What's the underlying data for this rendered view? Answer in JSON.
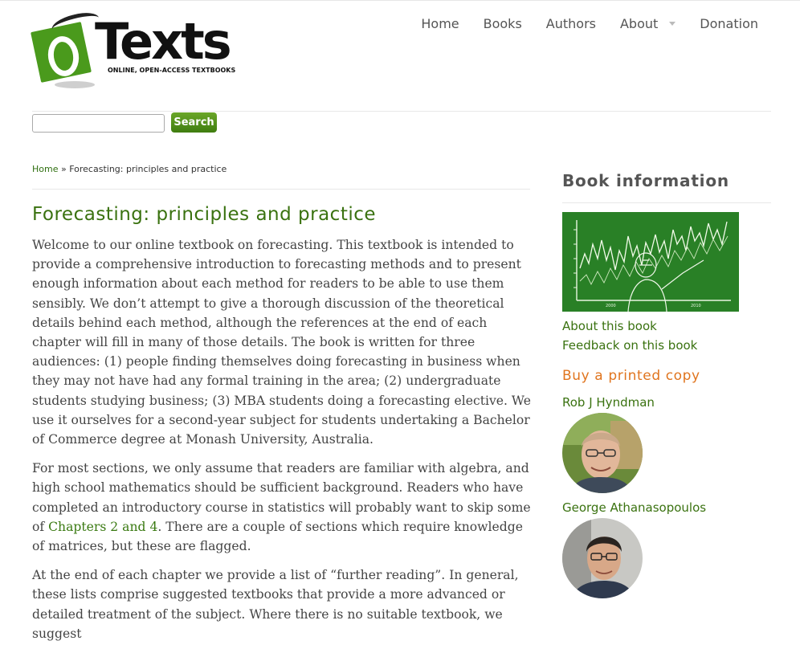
{
  "logo": {
    "text": "Texts",
    "tagline": "ONLINE, OPEN-ACCESS TEXTBOOKS",
    "colors": {
      "green": "#4a9a1c",
      "black": "#111111"
    }
  },
  "nav": {
    "items": [
      "Home",
      "Books",
      "Authors",
      "About",
      "Donation"
    ]
  },
  "search": {
    "value": "",
    "button_label": "Search"
  },
  "breadcrumb": {
    "home": "Home",
    "separator": "»",
    "current": "Forecasting: principles and practice"
  },
  "main": {
    "title": "Forecasting: principles and practice",
    "p1": "Welcome to our online textbook on forecasting. This textbook is intended to provide a comprehensive introduction to forecasting methods and to present enough information about each method for readers to be able to use them sensibly. We don’t attempt to give a thorough discussion of the theoretical details behind each method, although the references at the end of each chapter will fill in many of those details. The book is written for three audiences: (1) people finding themselves doing forecasting in business when they may not have had any formal training in the area; (2) undergraduate students studying business; (3) MBA students doing a forecasting elective. We use it ourselves for a second-year subject for students undertaking a Bachelor of Commerce degree at Monash University, Australia.",
    "p2_before": "For most sections, we only assume that readers are familiar with algebra, and high school mathematics should be sufficient background. Readers who have completed an introductory course in statistics will probably want to skip some of ",
    "p2_link": "Chapters 2 and 4",
    "p2_after": ". There are a couple of sections which require knowledge of matrices, but these are flagged.",
    "p3": "At the end of each chapter we provide a list of “further reading”. In general, these lists comprise suggested textbooks that provide a more advanced or detailed treatment of the subject. Where there is no suitable textbook, we suggest"
  },
  "sidebar": {
    "title": "Book information",
    "about_link": "About this book",
    "feedback_link": "Feedback on this book",
    "buy_label": "Buy a printed copy",
    "authors": [
      "Rob J Hyndman",
      "George Athanasopoulos"
    ],
    "cover_axis_years": [
      "2000",
      "2010"
    ]
  },
  "colors": {
    "link_green": "#3a7210",
    "accent_orange": "#e0751f",
    "button_green": "#4f8e1b",
    "cover_green": "#2f8a2a"
  }
}
